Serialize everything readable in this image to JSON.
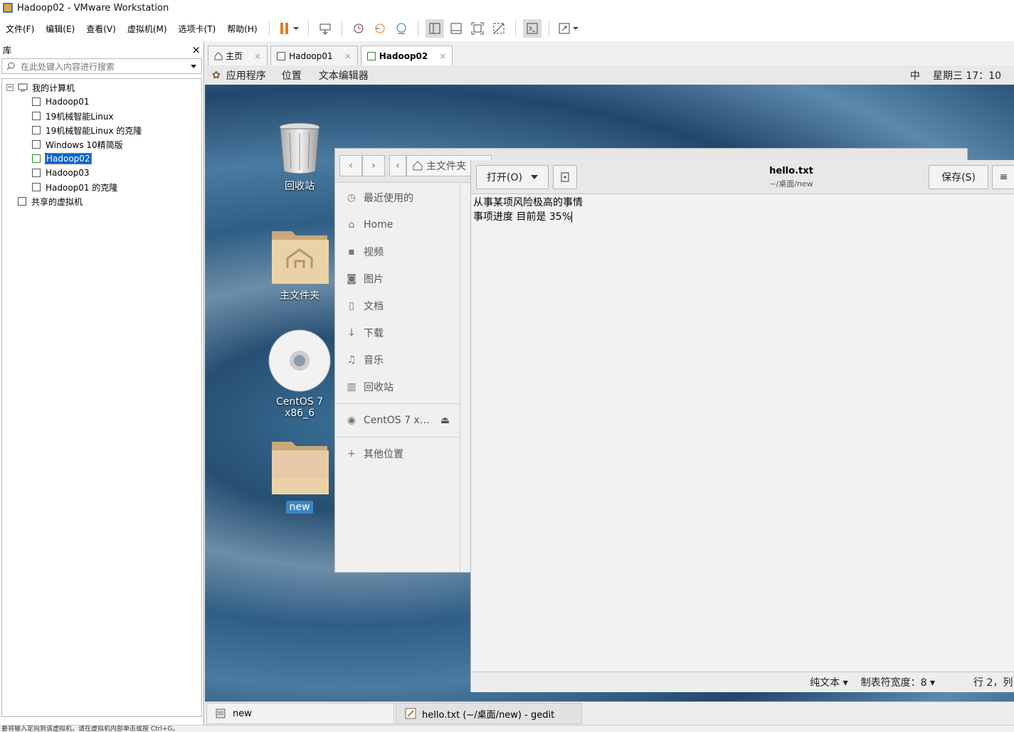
{
  "window": {
    "title": "Hadoop02 - VMware Workstation"
  },
  "menu": [
    "文件(F)",
    "编辑(E)",
    "查看(V)",
    "虚拟机(M)",
    "选项卡(T)",
    "帮助(H)"
  ],
  "library": {
    "title": "库",
    "close": "×",
    "search_placeholder": "在此处键入内容进行搜索",
    "root": "我的计算机",
    "vms": [
      "Hadoop01",
      "19机械智能Linux",
      "19机械智能Linux 的克隆",
      "Windows 10精简版",
      "Hadoop02",
      "Hadoop03",
      "Hadoop01 的克隆"
    ],
    "selected": "Hadoop02",
    "shared": "共享的虚拟机"
  },
  "tabs": [
    {
      "label": "主页",
      "close": "×"
    },
    {
      "label": "Hadoop01",
      "close": "×"
    },
    {
      "label": "Hadoop02",
      "close": "×"
    }
  ],
  "gnome_topbar": {
    "apps": "应用程序",
    "places": "位置",
    "current_app": "文本编辑器",
    "input_method": "中",
    "clock": "星期三 17：10"
  },
  "desktop": {
    "trash": "回收站",
    "home": "主文件夹",
    "dvd": "CentOS 7 x86_6",
    "new_folder": "new"
  },
  "nautilus": {
    "path": "主文件夹",
    "sidebar": [
      {
        "icon": "clock-icon",
        "label": "最近使用的"
      },
      {
        "icon": "home-icon",
        "label": "Home"
      },
      {
        "icon": "video-icon",
        "label": "视频"
      },
      {
        "icon": "camera-icon",
        "label": "图片"
      },
      {
        "icon": "document-icon",
        "label": "文档"
      },
      {
        "icon": "download-icon",
        "label": "下载"
      },
      {
        "icon": "music-icon",
        "label": "音乐"
      },
      {
        "icon": "trash-icon",
        "label": "回收站"
      }
    ],
    "device": "CentOS 7 x…",
    "other": "其他位置"
  },
  "gedit": {
    "open_label": "打开(O)",
    "title": "hello.txt",
    "subtitle": "~/桌面/new",
    "save_label": "保存(S)",
    "lines": [
      "从事某项风险极高的事情",
      "事项进度 目前是 35%"
    ],
    "status": {
      "syntax": "纯文本",
      "tab_width": "制表符宽度：8",
      "position": "行 2，列"
    }
  },
  "windowlist": [
    {
      "label": "new"
    },
    {
      "label": "hello.txt (~/桌面/new) - gedit"
    }
  ],
  "statusbar": "要将输入定向到该虚拟机，请在虚拟机内部单击或按 Ctrl+G。"
}
